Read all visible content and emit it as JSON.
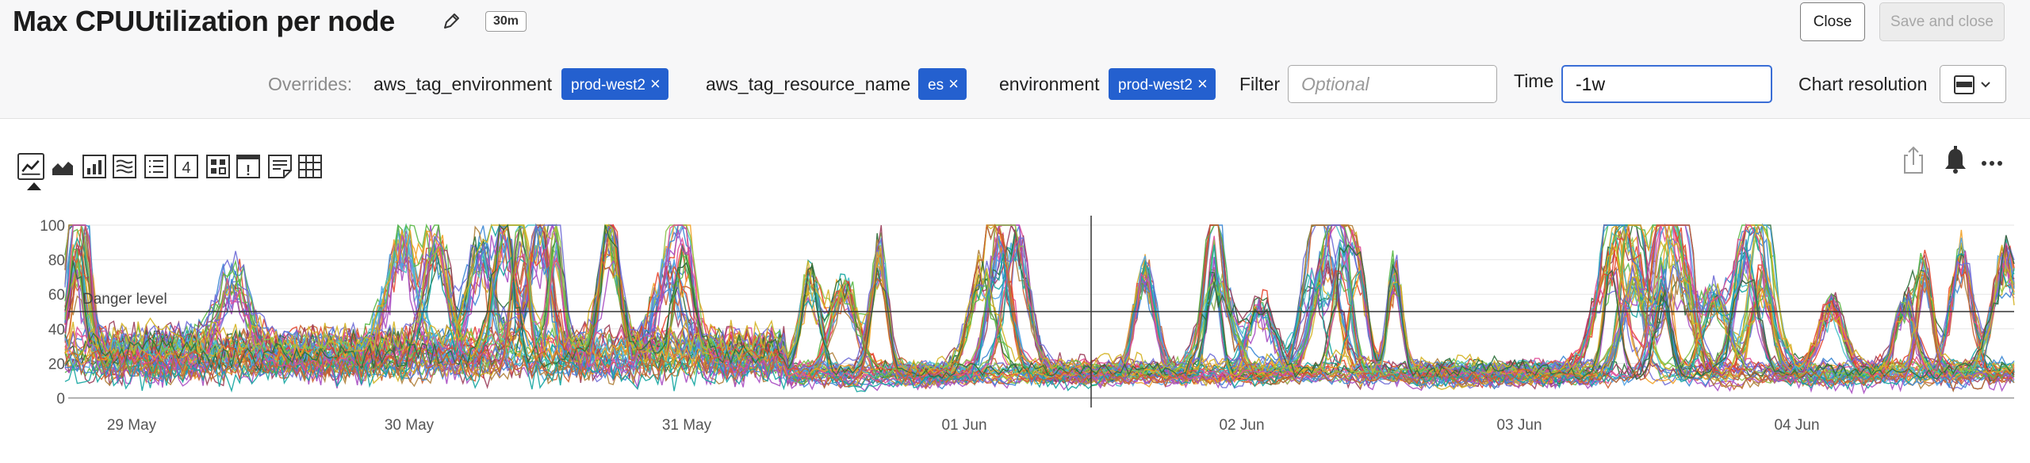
{
  "header": {
    "title": "Max CPUUtilization per node",
    "time_range_badge": "30m",
    "close_label": "Close",
    "save_label": "Save and close"
  },
  "overrides": {
    "label": "Overrides:",
    "items": [
      {
        "key": "aws_tag_environment",
        "value": "prod-west2"
      },
      {
        "key": "aws_tag_resource_name",
        "value": "es"
      },
      {
        "key": "environment",
        "value": "prod-west2"
      }
    ],
    "filter_label": "Filter",
    "filter_placeholder": "Optional",
    "time_label": "Time",
    "time_value": "-1w",
    "chart_resolution_label": "Chart resolution"
  },
  "visualization_types": [
    {
      "name": "line-chart-icon",
      "selected": true
    },
    {
      "name": "area-chart-icon",
      "selected": false
    },
    {
      "name": "column-chart-icon",
      "selected": false
    },
    {
      "name": "histogram-icon",
      "selected": false
    },
    {
      "name": "list-icon",
      "selected": false
    },
    {
      "name": "single-value-icon",
      "label": "4",
      "selected": false
    },
    {
      "name": "heatmap-icon",
      "selected": false
    },
    {
      "name": "event-feed-icon",
      "label": "!",
      "selected": false
    },
    {
      "name": "text-note-icon",
      "selected": false
    },
    {
      "name": "table-icon",
      "selected": false
    }
  ],
  "chart_data": {
    "type": "line",
    "y_ticks": [
      "100",
      "80",
      "60",
      "40",
      "20",
      "0"
    ],
    "ylim": [
      0,
      100
    ],
    "x_tick_labels": [
      "29 May",
      "30 May",
      "31 May",
      "01 Jun",
      "02 Jun",
      "03 Jun",
      "04 Jun"
    ],
    "threshold": {
      "label": "Danger level",
      "value": 50
    },
    "series_count": 60,
    "series_colors": [
      "#e5452d",
      "#3a86d4",
      "#59b845",
      "#f2a126",
      "#a84dc2",
      "#12a5a0",
      "#e04b97",
      "#8bc34a",
      "#6f6cd6",
      "#d4b322",
      "#2d6f3a",
      "#cc5f2d",
      "#4fa3e5",
      "#9b3d5a",
      "#47c1c9",
      "#b0813b"
    ]
  }
}
